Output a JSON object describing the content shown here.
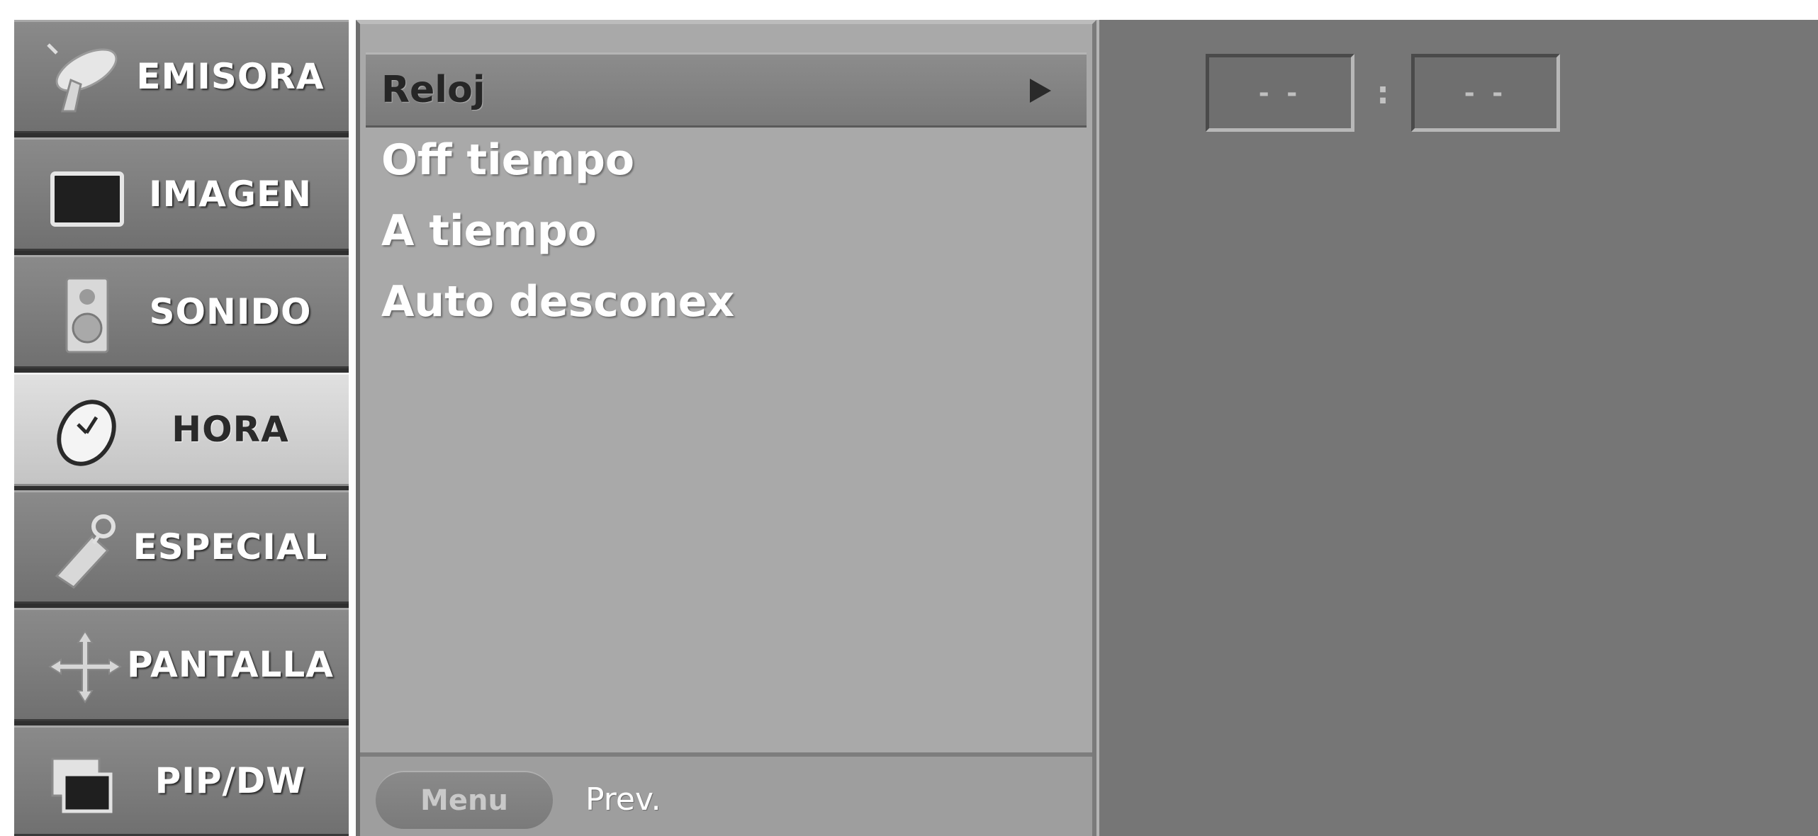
{
  "categories": [
    {
      "label": "EMISORA",
      "icon": "satellite-dish-icon",
      "active": false
    },
    {
      "label": "IMAGEN",
      "icon": "tv-screen-icon",
      "active": false
    },
    {
      "label": "SONIDO",
      "icon": "speaker-icon",
      "active": false
    },
    {
      "label": "HORA",
      "icon": "clock-icon",
      "active": true
    },
    {
      "label": "ESPECIAL",
      "icon": "tag-key-icon",
      "active": false
    },
    {
      "label": "PANTALLA",
      "icon": "move-arrows-icon",
      "active": false
    },
    {
      "label": "PIP/DW",
      "icon": "picture-in-picture-icon",
      "active": false
    }
  ],
  "submenu": {
    "selected": {
      "label": "Reloj",
      "arrow_icon": "triangle-right-icon"
    },
    "items": [
      "Off tiempo",
      "A tiempo",
      "Auto desconex"
    ]
  },
  "footer": {
    "menu_button": "Menu",
    "prev_label": "Prev."
  },
  "clock": {
    "hours": "- -",
    "separator": ":",
    "minutes": "- -"
  },
  "colors": {
    "sidebar": "#7c7c7c",
    "sidebar_active": "#d4d4d4",
    "submenu": "#a9a9a9",
    "value_area": "#767676",
    "text": "#ffffff"
  }
}
